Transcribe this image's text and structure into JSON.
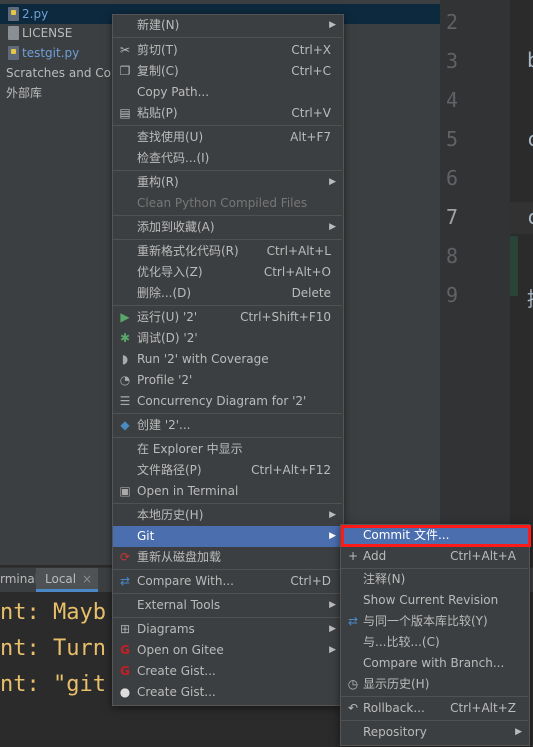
{
  "project_tree": {
    "items": [
      {
        "label": "2.py",
        "kind": "py",
        "color": "blue",
        "selected": true
      },
      {
        "label": "LICENSE",
        "kind": "txt",
        "color": "normal",
        "selected": false
      },
      {
        "label": "testgit.py",
        "kind": "py",
        "color": "blue",
        "selected": false
      },
      {
        "label": "Scratches and Cor",
        "kind": "scratch",
        "color": "normal",
        "selected": false
      },
      {
        "label": "外部库",
        "kind": "lib",
        "color": "normal",
        "selected": false
      }
    ]
  },
  "editor": {
    "line_numbers": [
      "2",
      "3",
      "4",
      "5",
      "6",
      "7",
      "8",
      "9"
    ],
    "current_line": "7",
    "code_chars": [
      "b",
      "c",
      "c",
      "提"
    ]
  },
  "terminal": {
    "label": "rminal:",
    "tab": "Local",
    "lines": [
      "nt: Mayb",
      "nt: Turn",
      "nt: \"git"
    ]
  },
  "context_menu": {
    "items": [
      {
        "label": "新建(N)",
        "shortcut": "",
        "submenu": true
      },
      {
        "label": "剪切(T)",
        "shortcut": "Ctrl+X",
        "icon": "scissors-icon"
      },
      {
        "label": "复制(C)",
        "shortcut": "Ctrl+C",
        "icon": "copy-icon"
      },
      {
        "label": "Copy Path...",
        "shortcut": ""
      },
      {
        "label": "粘贴(P)",
        "shortcut": "Ctrl+V",
        "icon": "paste-icon"
      },
      {
        "label": "查找使用(U)",
        "shortcut": "Alt+F7"
      },
      {
        "label": "检查代码...(I)",
        "shortcut": ""
      },
      {
        "label": "重构(R)",
        "shortcut": "",
        "submenu": true
      },
      {
        "label": "Clean Python Compiled Files",
        "shortcut": "",
        "disabled": true
      },
      {
        "label": "添加到收藏(A)",
        "shortcut": "",
        "submenu": true
      },
      {
        "label": "重新格式化代码(R)",
        "shortcut": "Ctrl+Alt+L"
      },
      {
        "label": "优化导入(Z)",
        "shortcut": "Ctrl+Alt+O"
      },
      {
        "label": "删除...(D)",
        "shortcut": "Delete"
      },
      {
        "label": "运行(U) '2'",
        "shortcut": "Ctrl+Shift+F10",
        "icon": "run-icon"
      },
      {
        "label": "调试(D) '2'",
        "shortcut": "",
        "icon": "debug-icon"
      },
      {
        "label": "Run '2' with Coverage",
        "shortcut": "",
        "icon": "coverage-icon"
      },
      {
        "label": "Profile '2'",
        "shortcut": "",
        "icon": "profile-icon"
      },
      {
        "label": "Concurrency Diagram for '2'",
        "shortcut": "",
        "icon": "concurrency-icon"
      },
      {
        "label": "创建 '2'...",
        "shortcut": "",
        "icon": "python-icon"
      },
      {
        "label": "在 Explorer 中显示",
        "shortcut": ""
      },
      {
        "label": "文件路径(P)",
        "shortcut": "Ctrl+Alt+F12"
      },
      {
        "label": "Open in Terminal",
        "shortcut": "",
        "icon": "terminal-icon"
      },
      {
        "label": "本地历史(H)",
        "shortcut": "",
        "submenu": true
      },
      {
        "label": "Git",
        "shortcut": "",
        "submenu": true,
        "highlighted": true
      },
      {
        "label": "重新从磁盘加载",
        "shortcut": "",
        "icon": "reload-icon"
      },
      {
        "label": "Compare With...",
        "shortcut": "Ctrl+D",
        "icon": "compare-icon"
      },
      {
        "label": "External Tools",
        "shortcut": "",
        "submenu": true
      },
      {
        "label": "Diagrams",
        "shortcut": "",
        "submenu": true,
        "icon": "diagram-icon"
      },
      {
        "label": "Open on Gitee",
        "shortcut": "",
        "submenu": true,
        "icon": "gitee-icon"
      },
      {
        "label": "Create Gist...",
        "shortcut": "",
        "icon": "gitee-icon"
      },
      {
        "label": "Create Gist...",
        "shortcut": "",
        "icon": "github-icon"
      }
    ]
  },
  "git_submenu": {
    "items": [
      {
        "label": "Commit 文件...",
        "shortcut": "",
        "highlighted": true
      },
      {
        "label": "Add",
        "shortcut": "Ctrl+Alt+A",
        "icon": "plus-icon"
      },
      {
        "label": "注释(N)",
        "shortcut": ""
      },
      {
        "label": "Show Current Revision",
        "shortcut": ""
      },
      {
        "label": "与同一个版本库比较(Y)",
        "shortcut": "",
        "icon": "compare-icon"
      },
      {
        "label": "与...比较...(C)",
        "shortcut": ""
      },
      {
        "label": "Compare with Branch...",
        "shortcut": ""
      },
      {
        "label": "显示历史(H)",
        "shortcut": "",
        "icon": "clock-icon"
      },
      {
        "label": "Rollback...",
        "shortcut": "Ctrl+Alt+Z",
        "icon": "rollback-icon"
      },
      {
        "label": "Repository",
        "shortcut": "",
        "submenu": true
      }
    ]
  },
  "colors": {
    "highlight": "#4b6eaf",
    "annotation_box": "#ff1a1a"
  }
}
